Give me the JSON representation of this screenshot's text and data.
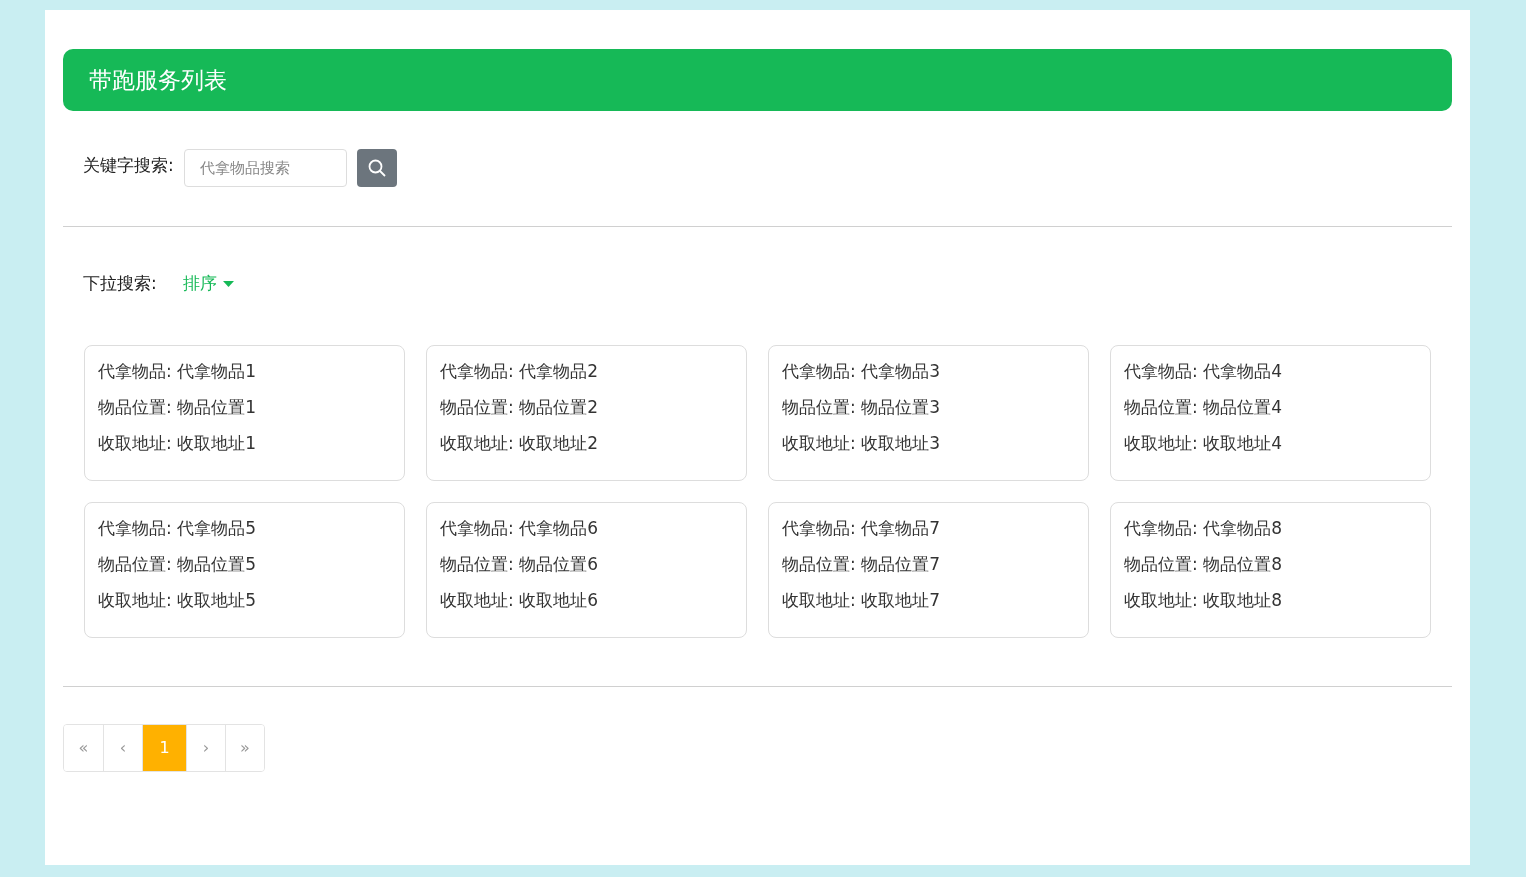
{
  "header": {
    "title": "带跑服务列表"
  },
  "keyword_search": {
    "label": "关键字搜索:",
    "placeholder": "代拿物品搜索"
  },
  "dropdown_search": {
    "label": "下拉搜索:",
    "dropdown": "排序"
  },
  "cards": [
    {
      "lines": [
        "代拿物品: 代拿物品1",
        "物品位置: 物品位置1",
        "收取地址: 收取地址1"
      ]
    },
    {
      "lines": [
        "代拿物品: 代拿物品2",
        "物品位置: 物品位置2",
        "收取地址: 收取地址2"
      ]
    },
    {
      "lines": [
        "代拿物品: 代拿物品3",
        "物品位置: 物品位置3",
        "收取地址: 收取地址3"
      ]
    },
    {
      "lines": [
        "代拿物品: 代拿物品4",
        "物品位置: 物品位置4",
        "收取地址: 收取地址4"
      ]
    },
    {
      "lines": [
        "代拿物品: 代拿物品5",
        "物品位置: 物品位置5",
        "收取地址: 收取地址5"
      ]
    },
    {
      "lines": [
        "代拿物品: 代拿物品6",
        "物品位置: 物品位置6",
        "收取地址: 收取地址6"
      ]
    },
    {
      "lines": [
        "代拿物品: 代拿物品7",
        "物品位置: 物品位置7",
        "收取地址: 收取地址7"
      ]
    },
    {
      "lines": [
        "代拿物品: 代拿物品8",
        "物品位置: 物品位置8",
        "收取地址: 收取地址8"
      ]
    }
  ],
  "pagination": [
    {
      "label": "«",
      "selected": false
    },
    {
      "label": "‹",
      "selected": false
    },
    {
      "label": "1",
      "selected": true
    },
    {
      "label": "›",
      "selected": false
    },
    {
      "label": "»",
      "selected": false
    }
  ]
}
